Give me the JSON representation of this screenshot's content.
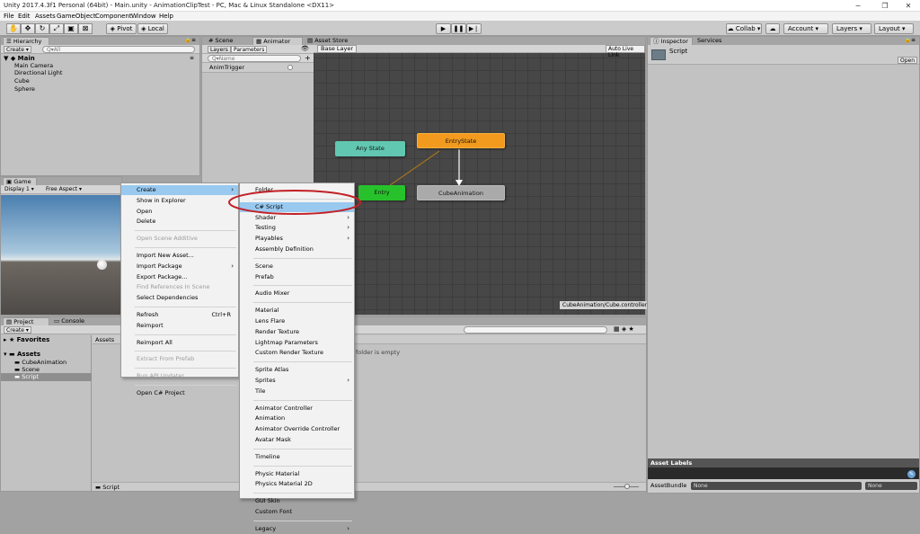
{
  "window": {
    "title": "Unity 2017.4.3f1 Personal (64bit) - Main.unity - AnimationClipTest - PC, Mac & Linux Standalone <DX11>"
  },
  "menu": [
    "File",
    "Edit",
    "Assets",
    "GameObject",
    "Component",
    "Window",
    "Help"
  ],
  "toolbar": {
    "pivot": "Pivot",
    "local": "Local",
    "collab": "Collab",
    "account": "Account",
    "layers": "Layers",
    "layout": "Layout"
  },
  "hierarchy": {
    "tab": "Hierarchy",
    "create": "Create",
    "search": "Q▾All",
    "scene": "Main",
    "items": [
      "Main Camera",
      "Directional Light",
      "Cube",
      "Sphere"
    ]
  },
  "scene_tabs": {
    "scene": "Scene",
    "animator": "Animator",
    "asset_store": "Asset Store"
  },
  "animator": {
    "layers_tab": "Layers",
    "parameters_tab": "Parameters",
    "search": "Q▾Name",
    "param": "AnimTrigger",
    "base_layer": "Base Layer",
    "auto_live_link": "Auto Live Link",
    "nodes": {
      "any_state": "Any State",
      "entry_state": "EntryState",
      "entry": "Entry",
      "cube_animation": "CubeAnimation"
    },
    "footer": "CubeAnimation/Cube.controller"
  },
  "game": {
    "tab": "Game",
    "display": "Display 1",
    "aspect": "Free Aspect"
  },
  "project": {
    "tab": "Project",
    "console_tab": "Console",
    "create": "Create",
    "favorites": "Favorites",
    "assets": "Assets",
    "folders": [
      "CubeAnimation",
      "Scene",
      "Script"
    ],
    "breadcrumb": "Assets",
    "empty": "folder is empty",
    "footer": "Script"
  },
  "inspector": {
    "tab": "Inspector",
    "services_tab": "Services",
    "name": "Script",
    "open": "Open",
    "asset_labels": "Asset Labels",
    "asset_bundle": "AssetBundle",
    "bundle_value": "None",
    "bundle_variant": "None"
  },
  "context_menu": [
    {
      "label": "Create",
      "state": "highlighted",
      "sub": true
    },
    {
      "label": "Show in Explorer"
    },
    {
      "label": "Open"
    },
    {
      "label": "Delete"
    },
    {
      "sep": true
    },
    {
      "label": "Open Scene Additive",
      "state": "disabled"
    },
    {
      "sep": true
    },
    {
      "label": "Import New Asset..."
    },
    {
      "label": "Import Package",
      "sub": true
    },
    {
      "label": "Export Package..."
    },
    {
      "label": "Find References In Scene",
      "state": "disabled"
    },
    {
      "label": "Select Dependencies"
    },
    {
      "sep": true
    },
    {
      "label": "Refresh",
      "shortcut": "Ctrl+R"
    },
    {
      "label": "Reimport"
    },
    {
      "sep": true
    },
    {
      "label": "Reimport All"
    },
    {
      "sep": true
    },
    {
      "label": "Extract From Prefab",
      "state": "disabled"
    },
    {
      "sep": true
    },
    {
      "label": "Run API Updater...",
      "state": "disabled"
    },
    {
      "sep": true
    },
    {
      "label": "Open C# Project"
    }
  ],
  "submenu": [
    {
      "label": "Folder"
    },
    {
      "sep": true
    },
    {
      "label": "C# Script",
      "state": "highlighted"
    },
    {
      "label": "Shader",
      "sub": true
    },
    {
      "label": "Testing",
      "sub": true
    },
    {
      "label": "Playables",
      "sub": true
    },
    {
      "label": "Assembly Definition"
    },
    {
      "sep": true
    },
    {
      "label": "Scene"
    },
    {
      "label": "Prefab"
    },
    {
      "sep": true
    },
    {
      "label": "Audio Mixer"
    },
    {
      "sep": true
    },
    {
      "label": "Material"
    },
    {
      "label": "Lens Flare"
    },
    {
      "label": "Render Texture"
    },
    {
      "label": "Lightmap Parameters"
    },
    {
      "label": "Custom Render Texture"
    },
    {
      "sep": true
    },
    {
      "label": "Sprite Atlas"
    },
    {
      "label": "Sprites",
      "sub": true
    },
    {
      "label": "Tile"
    },
    {
      "sep": true
    },
    {
      "label": "Animator Controller"
    },
    {
      "label": "Animation"
    },
    {
      "label": "Animator Override Controller"
    },
    {
      "label": "Avatar Mask"
    },
    {
      "sep": true
    },
    {
      "label": "Timeline"
    },
    {
      "sep": true
    },
    {
      "label": "Physic Material"
    },
    {
      "label": "Physics Material 2D"
    },
    {
      "sep": true
    },
    {
      "label": "GUI Skin"
    },
    {
      "label": "Custom Font"
    },
    {
      "sep": true
    },
    {
      "label": "Legacy",
      "sub": true
    }
  ],
  "colors": {
    "highlight": "#99c9ef",
    "any_state": "#62c7b1",
    "entry_state": "#f29a1e",
    "entry": "#27c22b",
    "cube_anim": "#aaaaaa",
    "grid": "#4a4a4a",
    "callout": "#c22026"
  }
}
